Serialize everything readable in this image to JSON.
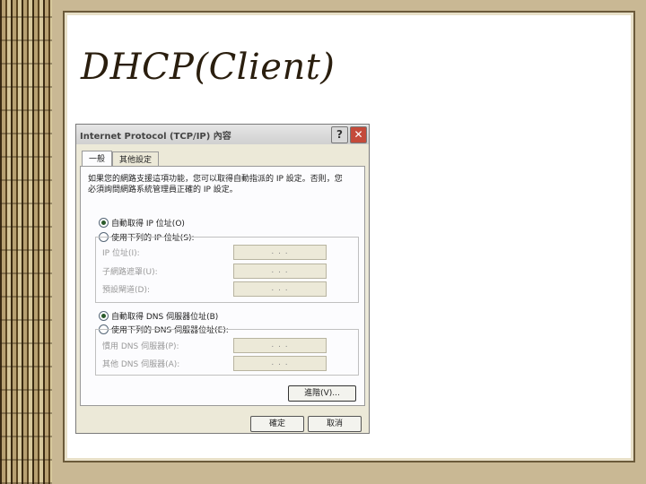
{
  "slide": {
    "title": "DHCP(Client)"
  },
  "dialog": {
    "title": "Internet Protocol (TCP/IP) 內容",
    "help_glyph": "?",
    "close_glyph": "✕",
    "tabs": [
      {
        "label": "一般"
      },
      {
        "label": "其他設定"
      }
    ],
    "description": "如果您的網路支援這項功能，您可以取得自動指派的 IP 設定。否則，您必須詢問網路系統管理員正確的 IP 設定。",
    "ip_options": {
      "auto_label": "自動取得 IP 位址(O)",
      "manual_label": "使用下列的 IP 位址(S):",
      "selected": "auto"
    },
    "ip_fields": [
      {
        "label": "IP 位址(I):",
        "value": ".   .   ."
      },
      {
        "label": "子網路遮罩(U):",
        "value": ".   .   ."
      },
      {
        "label": "預設閘道(D):",
        "value": ".   .   ."
      }
    ],
    "dns_options": {
      "auto_label": "自動取得 DNS 伺服器位址(B)",
      "manual_label": "使用下列的 DNS 伺服器位址(E):",
      "selected": "auto"
    },
    "dns_fields": [
      {
        "label": "慣用 DNS 伺服器(P):",
        "value": ".   .   ."
      },
      {
        "label": "其他 DNS 伺服器(A):",
        "value": ".   .   ."
      }
    ],
    "advanced_label": "進階(V)...",
    "ok_label": "確定",
    "cancel_label": "取消"
  }
}
